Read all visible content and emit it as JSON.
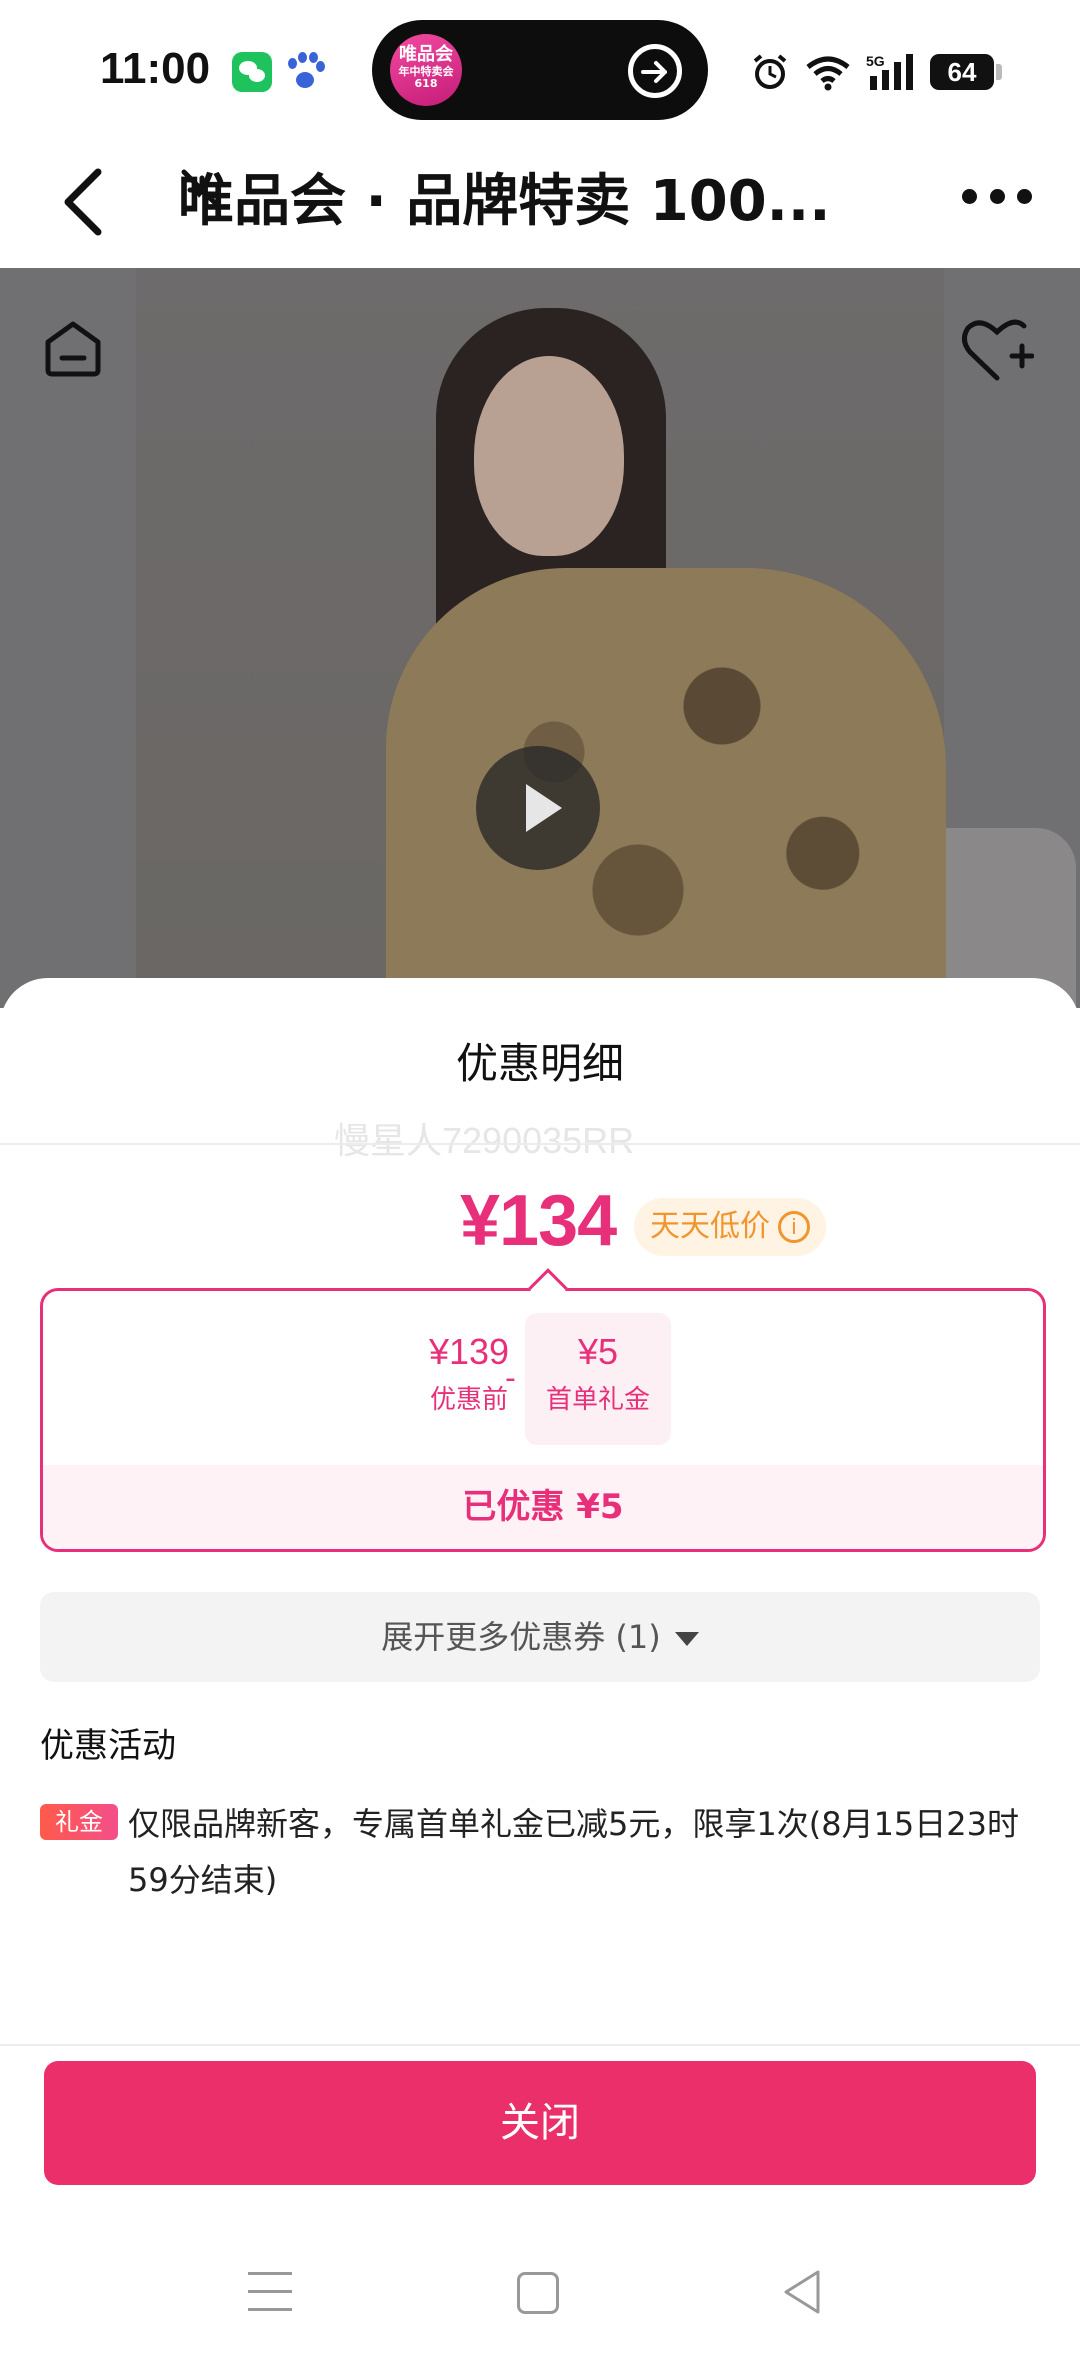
{
  "status_bar": {
    "time": "11:00",
    "network": "5G",
    "battery": "64",
    "island_logo_lines": [
      "唯品会",
      "年中特卖会",
      "618"
    ]
  },
  "nav": {
    "title": "唯品会 · 品牌特卖 100..."
  },
  "icons": {
    "back": "back-arrow-icon",
    "minimize": "minimize-icon",
    "more": "more-icon",
    "home": "home-icon",
    "favorite": "heart-plus-icon",
    "play": "play-icon"
  },
  "sheet": {
    "title": "优惠明细",
    "watermark": "慢星人7290035RR",
    "final_price": "¥134",
    "price_tag": "天天低价",
    "calc": {
      "before_value": "¥139",
      "before_label": "优惠前",
      "minus": "-",
      "coupon_value": "¥5",
      "coupon_label": "首单礼金"
    },
    "saved": "已优惠 ¥5",
    "expand_label": "展开更多优惠券 (1)",
    "activity_title": "优惠活动",
    "activity_badge": "礼金",
    "activity_text": "仅限品牌新客，专属首单礼金已减5元，限享1次(8月15日23时59分结束)",
    "close_label": "关闭"
  },
  "colors": {
    "accent": "#e8307a",
    "button": "#ea2f6a",
    "tag": "#f0962d"
  }
}
